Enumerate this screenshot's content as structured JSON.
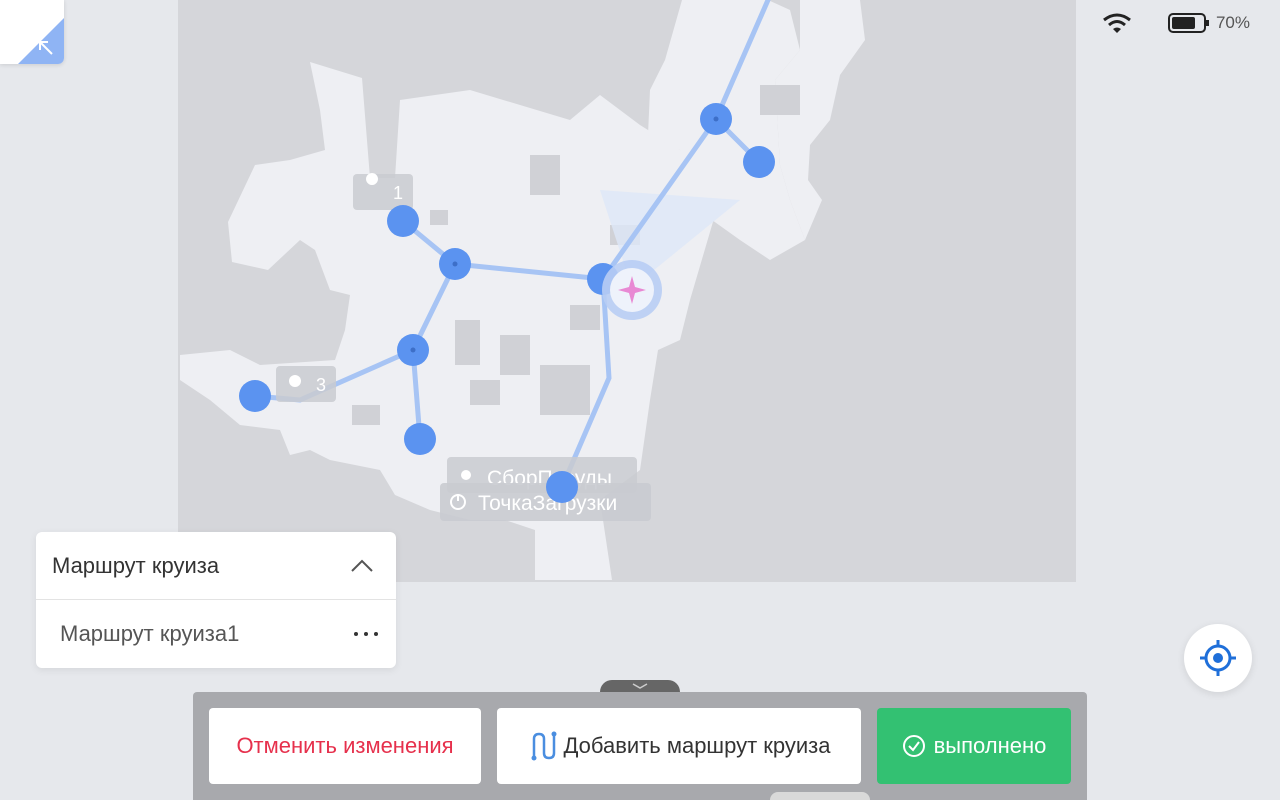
{
  "status": {
    "battery_text": "70%"
  },
  "map": {
    "labels": {
      "point_1": "1",
      "point_3": "3",
      "dish_collection": "СборПосуды",
      "charging_point": "ТочкаЗагрузки"
    }
  },
  "route_panel": {
    "title": "Маршрут круиза",
    "items": [
      {
        "label": "Маршрут круиза1"
      }
    ]
  },
  "toolbar": {
    "cancel_label": "Отменить изменения",
    "add_route_label": "Добавить маршрут круиза",
    "done_label": "выполнено"
  },
  "colors": {
    "accent_blue": "#5b93f0",
    "cancel_red": "#e6304c",
    "done_green": "#33c172",
    "locate_blue": "#1f6fd9"
  },
  "icons": [
    "collapse-arrow-icon",
    "wifi-icon",
    "battery-icon",
    "location-pin-icon",
    "water-drop-icon",
    "power-icon",
    "robot-position-icon",
    "chevron-up-icon",
    "more-dots-icon",
    "locate-crosshair-icon",
    "route-icon",
    "check-circle-icon",
    "chevron-down-icon"
  ]
}
